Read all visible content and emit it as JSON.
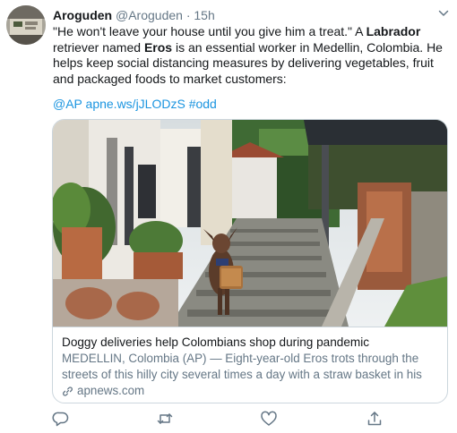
{
  "user": {
    "display_name": "Aroguden",
    "handle": "@Aroguden",
    "separator": "·",
    "time": "15h"
  },
  "tweet": {
    "text_part1": "\"He won't leave your house until you give him a treat.\" A ",
    "bold1": "Labrador",
    "text_part2": " retriever named ",
    "bold2": "Eros",
    "text_part3": " is an essential worker in Medellin, Colombia. He helps keep social distancing measures by delivering vegetables, fruit and packaged foods to market customers:",
    "mention": "@AP",
    "link": "apne.ws/jJLODzS",
    "hashtag": "#odd"
  },
  "card": {
    "title": "Doggy deliveries help Colombians shop during pandemic",
    "description": "MEDELLIN, Colombia (AP) — Eight-year-old Eros trots through the streets of this hilly city several times a day with a straw basket in his jaws, takin...",
    "domain": "apnews.com"
  },
  "icons": {
    "reply": "reply-icon",
    "retweet": "retweet-icon",
    "like": "heart-icon",
    "share": "share-icon",
    "caret": "chevron-down-icon",
    "link": "link-icon"
  },
  "colors": {
    "link_blue": "#1b95e0",
    "secondary_gray": "#657786",
    "text_dark": "#14171a",
    "border": "#ccd6dd"
  }
}
